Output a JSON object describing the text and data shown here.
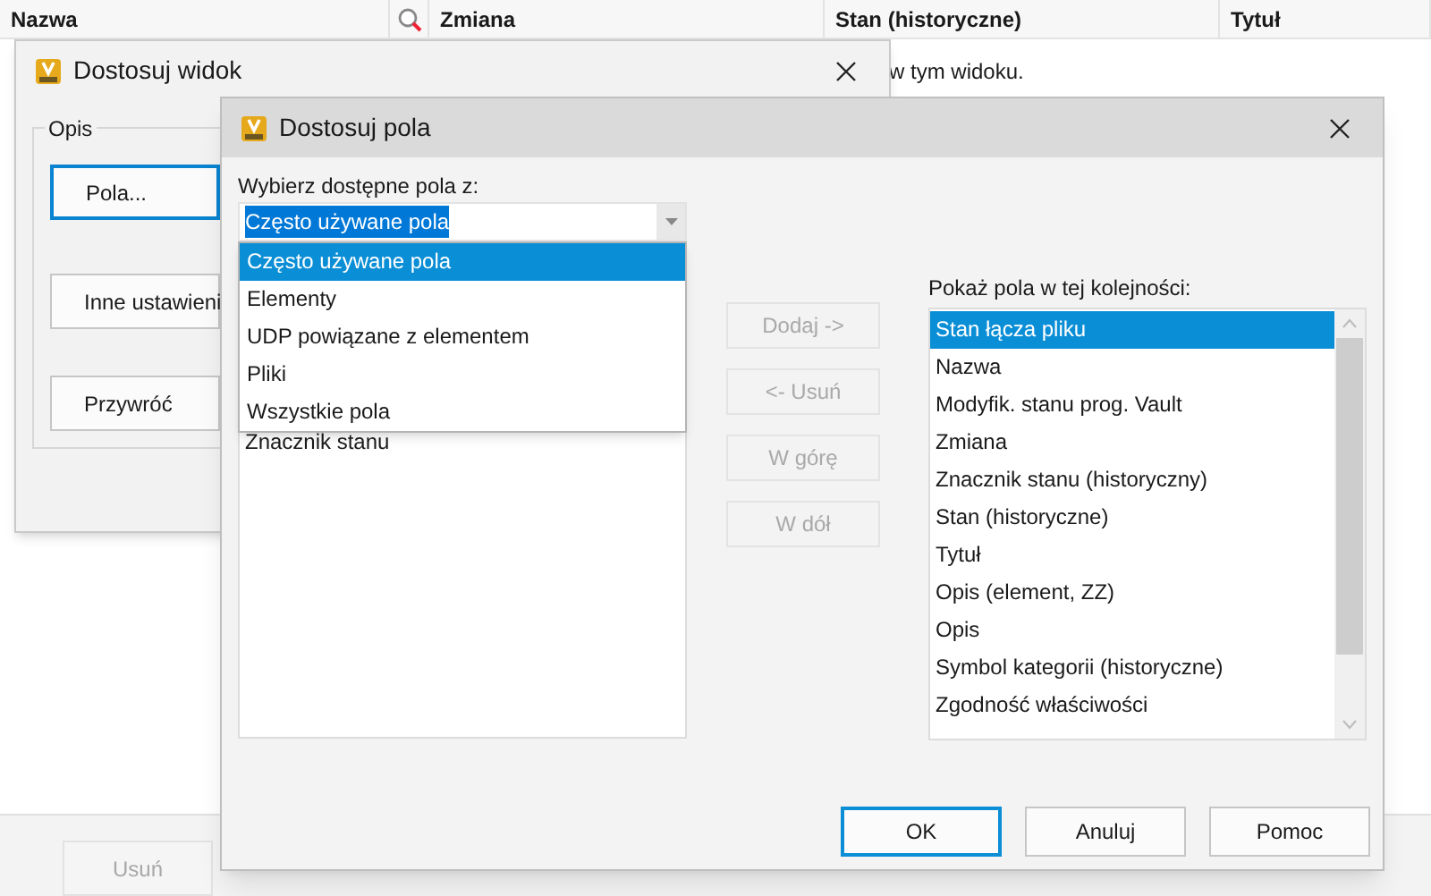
{
  "background_table": {
    "columns": [
      {
        "kind": "text",
        "label": "Nazwa"
      },
      {
        "kind": "icon"
      },
      {
        "kind": "text",
        "label": "Zmiana"
      },
      {
        "kind": "text",
        "label": "Stan (historyczne)"
      },
      {
        "kind": "text",
        "label": "Tytuł"
      }
    ],
    "message": "w tym widoku."
  },
  "bottom_buttons": [
    {
      "label": "Usuń",
      "disabled": true
    }
  ],
  "customize_view_dialog": {
    "title": "Dostosuj widok",
    "group_label": "Opis",
    "buttons": [
      {
        "label": "Pola...",
        "focused": true
      },
      {
        "label": "Inne ustawieni",
        "focused": false
      },
      {
        "label": "Przywróć",
        "focused": false
      }
    ]
  },
  "customize_fields_dialog": {
    "title": "Dostosuj pola",
    "source_label": "Wybierz dostępne pola z:",
    "source_combo": {
      "value": "Często używane pola",
      "expanded": true,
      "options": [
        {
          "label": "Często używane pola",
          "selected": true
        },
        {
          "label": "Elementy",
          "selected": false
        },
        {
          "label": "UDP powiązane z elementem",
          "selected": false
        },
        {
          "label": "Pliki",
          "selected": false
        },
        {
          "label": "Wszystkie pola",
          "selected": false
        }
      ]
    },
    "available_fields": [
      "Znacznik stanu"
    ],
    "middle_buttons": [
      {
        "label": "Dodaj ->",
        "disabled": true
      },
      {
        "label": "<- Usuń",
        "disabled": true
      },
      {
        "label": "W górę",
        "disabled": true
      },
      {
        "label": "W dół",
        "disabled": true
      }
    ],
    "order_label": "Pokaż pola w tej kolejności:",
    "order_list": [
      {
        "label": "Stan łącza pliku",
        "selected": true
      },
      {
        "label": "Nazwa",
        "selected": false
      },
      {
        "label": "Modyfik. stanu prog. Vault",
        "selected": false
      },
      {
        "label": "Zmiana",
        "selected": false
      },
      {
        "label": "Znacznik stanu (historyczny)",
        "selected": false
      },
      {
        "label": "Stan (historyczne)",
        "selected": false
      },
      {
        "label": "Tytuł",
        "selected": false
      },
      {
        "label": "Opis (element, ZZ)",
        "selected": false
      },
      {
        "label": "Opis",
        "selected": false
      },
      {
        "label": "Symbol kategorii (historyczne)",
        "selected": false
      },
      {
        "label": "Zgodność właściwości",
        "selected": false
      }
    ],
    "footer_buttons": [
      {
        "label": "OK",
        "focused": true
      },
      {
        "label": "Anuluj",
        "focused": false
      },
      {
        "label": "Pomoc",
        "focused": false
      }
    ]
  }
}
